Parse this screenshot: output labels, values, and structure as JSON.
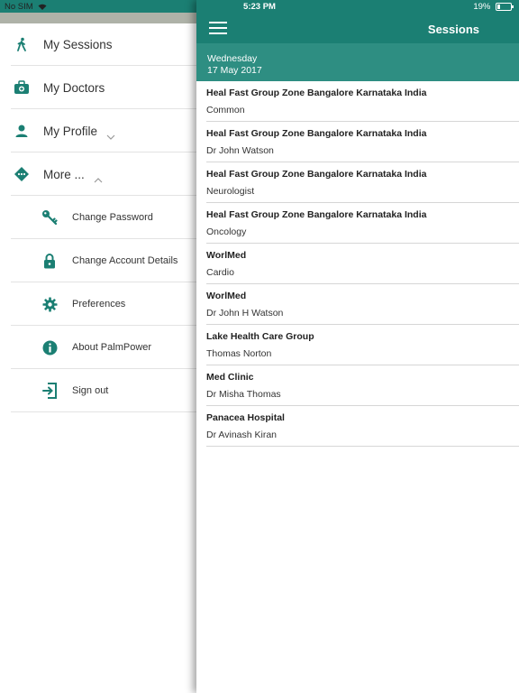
{
  "status_bar": {
    "carrier": "No SIM",
    "time": "5:23 PM",
    "battery": "19%",
    "battery_level": 0.19
  },
  "drawer": {
    "items": [
      {
        "label": "My Sessions",
        "icon": "walking-person-icon"
      },
      {
        "label": "My Doctors",
        "icon": "medical-bag-icon"
      },
      {
        "label": "My Profile",
        "icon": "person-icon",
        "chevron": "down"
      },
      {
        "label": "More ...",
        "icon": "more-dots-icon",
        "chevron": "up"
      }
    ],
    "sub_items": [
      {
        "label": "Change Password",
        "icon": "key-icon"
      },
      {
        "label": "Change Account Details",
        "icon": "lock-icon"
      },
      {
        "label": "Preferences",
        "icon": "gear-icon"
      },
      {
        "label": "About PalmPower",
        "icon": "info-icon"
      },
      {
        "label": "Sign out",
        "icon": "sign-out-icon"
      }
    ]
  },
  "header": {
    "title": "Sessions"
  },
  "date": {
    "weekday": "Wednesday",
    "date": "17 May 2017"
  },
  "sessions": [
    {
      "name": "Heal Fast Group Zone Bangalore Karnataka India",
      "detail": "Common"
    },
    {
      "name": "Heal Fast Group Zone Bangalore Karnataka India",
      "detail": "Dr John Watson"
    },
    {
      "name": "Heal Fast Group Zone Bangalore Karnataka India",
      "detail": "Neurologist"
    },
    {
      "name": "Heal Fast Group Zone Bangalore Karnataka India",
      "detail": "Oncology"
    },
    {
      "name": "WorlMed",
      "detail": "Cardio"
    },
    {
      "name": "WorlMed",
      "detail": "Dr John H Watson"
    },
    {
      "name": "Lake Health Care Group",
      "detail": "Thomas Norton"
    },
    {
      "name": "Med Clinic",
      "detail": "Dr Misha Thomas"
    },
    {
      "name": "Panacea Hospital",
      "detail": "Dr Avinash Kiran"
    }
  ],
  "colors": {
    "brand": "#1b7f73",
    "date_band": "#2e8e82",
    "icon": "#1b7f73"
  }
}
